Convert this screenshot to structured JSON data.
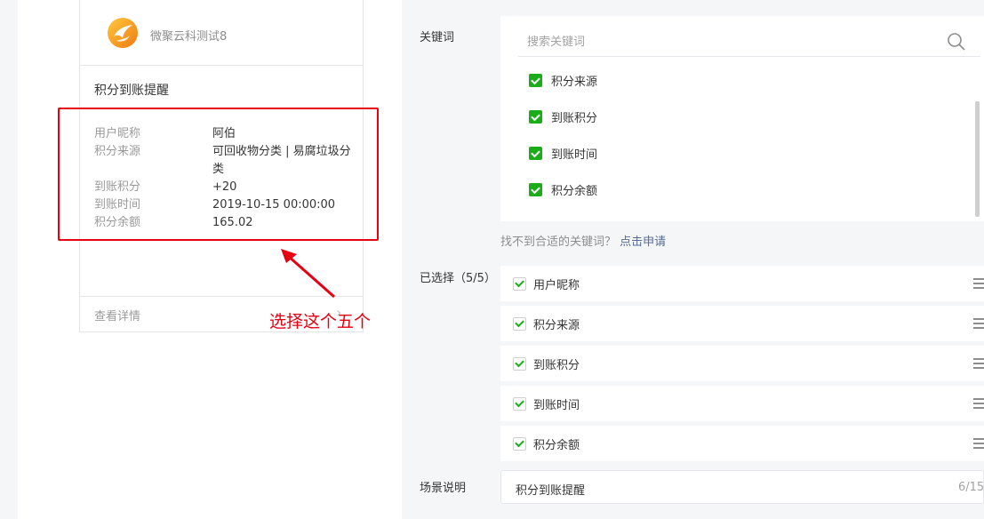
{
  "preview": {
    "account_name": "微聚云科测试8",
    "title": "积分到账提醒",
    "fields": [
      {
        "key": "用户昵称",
        "value": "阿伯"
      },
      {
        "key": "积分来源",
        "value": "可回收物分类 | 易腐垃圾分类"
      },
      {
        "key": "到账积分",
        "value": "+20"
      },
      {
        "key": "到账时间",
        "value": "2019-10-15 00:00:00"
      },
      {
        "key": "积分余额",
        "value": "165.02"
      }
    ],
    "detail_label": "查看详情"
  },
  "annotation": {
    "text": "选择这个五个",
    "color": "#e60012"
  },
  "keywords": {
    "label": "关键词",
    "search_placeholder": "搜索关键词",
    "items": [
      "积分来源",
      "到账积分",
      "到账时间",
      "积分余额"
    ],
    "hint_text": "找不到合适的关键词？",
    "apply_link": "点击申请"
  },
  "selected": {
    "label": "已选择（5/5）",
    "items": [
      "用户昵称",
      "积分来源",
      "到账积分",
      "到账时间",
      "积分余额"
    ]
  },
  "scene": {
    "label": "场景说明",
    "value": "积分到账提醒",
    "count": "6/15"
  },
  "colors": {
    "accent_green": "#1aad19",
    "link_blue": "#576b95",
    "annotation_red": "#e60012"
  }
}
